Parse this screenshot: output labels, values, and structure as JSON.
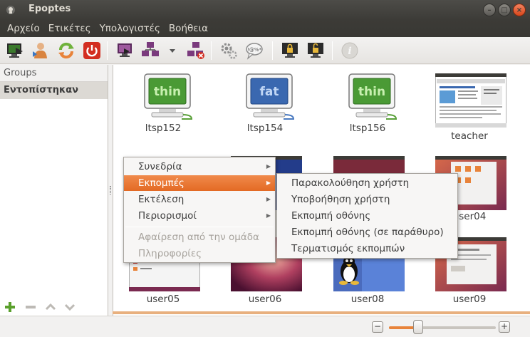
{
  "window": {
    "title": "Epoptes"
  },
  "menubar": [
    "Αρχείο",
    "Ετικέτες",
    "Υπολογιστές",
    "Βοήθεια"
  ],
  "sidebar": {
    "header": "Groups",
    "items": [
      "Εντοπίστηκαν"
    ]
  },
  "clients": [
    {
      "label": "ltsp152",
      "type": "thin"
    },
    {
      "label": "ltsp154",
      "type": "fat"
    },
    {
      "label": "ltsp156",
      "type": "thin"
    },
    {
      "label": "teacher",
      "type": "screen"
    },
    {
      "label": "user04",
      "type": "screen"
    },
    {
      "label": "user05",
      "type": "screen"
    },
    {
      "label": "user06",
      "type": "screen"
    },
    {
      "label": "user08",
      "type": "screen"
    },
    {
      "label": "user09",
      "type": "screen"
    }
  ],
  "context_menu": {
    "items": [
      {
        "label": "Συνεδρία",
        "submenu": true,
        "state": "normal"
      },
      {
        "label": "Εκπομπές",
        "submenu": true,
        "state": "active"
      },
      {
        "label": "Εκτέλεση",
        "submenu": true,
        "state": "normal"
      },
      {
        "label": "Περιορισμοί",
        "submenu": true,
        "state": "normal"
      },
      {
        "label": "Αφαίρεση από την ομάδα",
        "submenu": false,
        "state": "disabled"
      },
      {
        "label": "Πληροφορίες",
        "submenu": false,
        "state": "disabled"
      }
    ]
  },
  "submenu": {
    "items": [
      "Παρακολούθηση χρήστη",
      "Υποβοήθηση χρήστη",
      "Εκπομπή οθόνης",
      "Εκπομπή οθόνης (σε παράθυρο)",
      "Τερματισμός εκπομπών"
    ]
  },
  "zoom": {
    "minus": "−",
    "plus": "+",
    "level": 0.27
  },
  "colors": {
    "accent": "#e36a24",
    "titlebar": "#3c3b37",
    "thin": "#4a9a35",
    "fat": "#3a68b0"
  }
}
